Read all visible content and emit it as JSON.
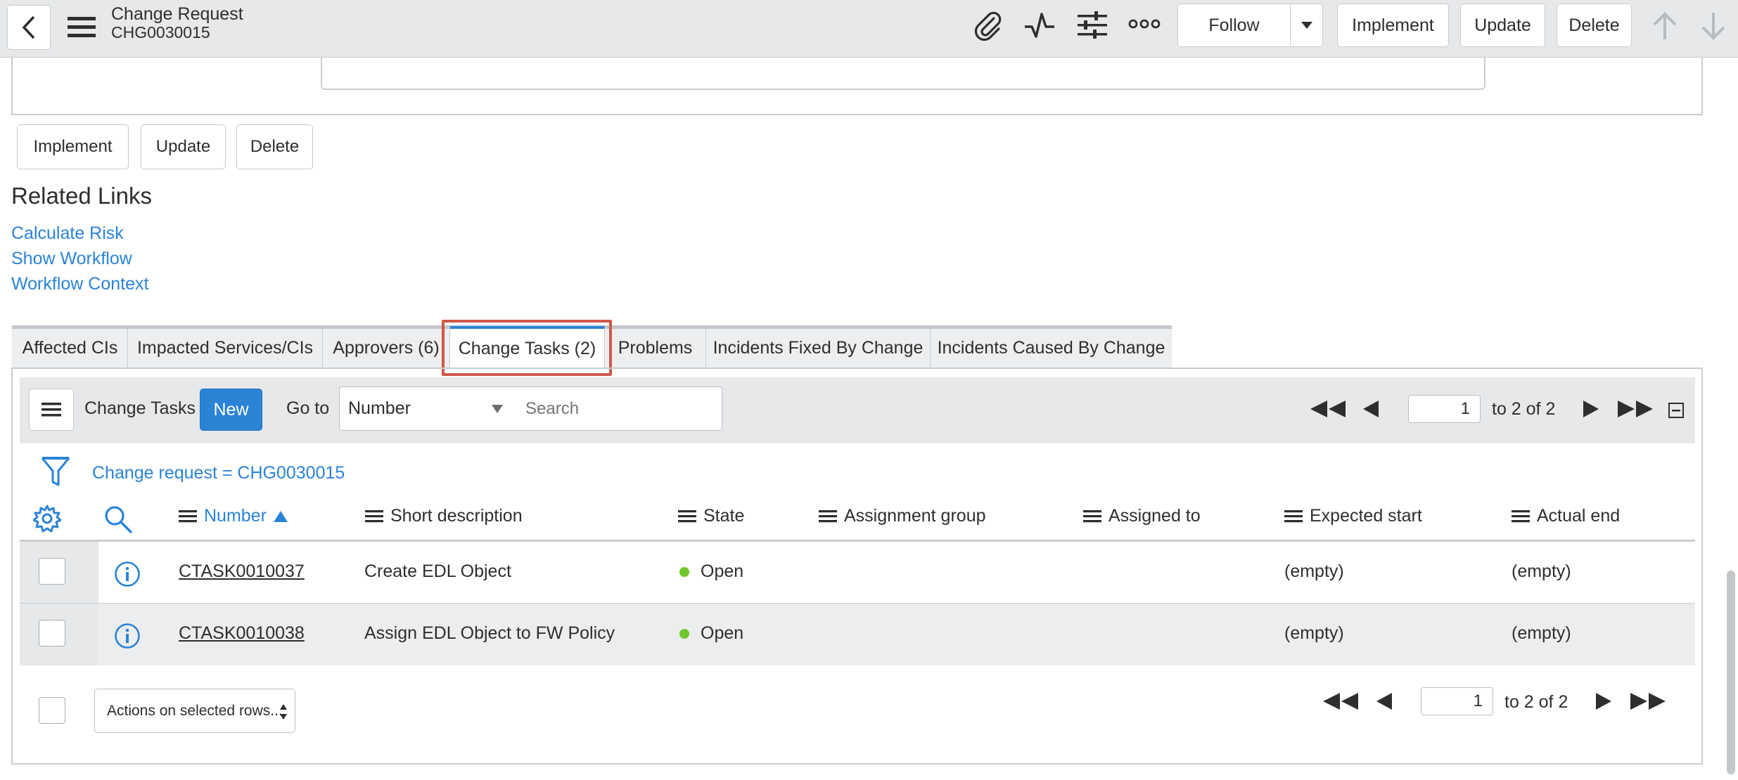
{
  "header": {
    "record_type": "Change Request",
    "record_number": "CHG0030015",
    "follow_label": "Follow",
    "implement_label": "Implement",
    "update_label": "Update",
    "delete_label": "Delete"
  },
  "form_buttons": {
    "implement_label": "Implement",
    "update_label": "Update",
    "delete_label": "Delete"
  },
  "related_links": {
    "title": "Related Links",
    "links": [
      "Calculate Risk",
      "Show Workflow",
      "Workflow Context"
    ]
  },
  "tabs": [
    {
      "label": "Affected CIs"
    },
    {
      "label": "Impacted Services/CIs"
    },
    {
      "label": "Approvers (6)"
    },
    {
      "label": "Change Tasks (2)",
      "active": true
    },
    {
      "label": "Problems"
    },
    {
      "label": "Incidents Fixed By Change"
    },
    {
      "label": "Incidents Caused By Change"
    }
  ],
  "list": {
    "title": "Change Tasks",
    "new_label": "New",
    "goto_label": "Go to",
    "goto_select": "Number",
    "search_placeholder": "Search",
    "page_value": "1",
    "page_range": "to 2 of 2",
    "filter_text": "Change request = CHG0030015",
    "columns": [
      "Number",
      "Short description",
      "State",
      "Assignment group",
      "Assigned to",
      "Expected start",
      "Actual end"
    ],
    "rows": [
      {
        "number": "CTASK0010037",
        "short_description": "Create EDL Object",
        "state": "Open",
        "assignment_group": "",
        "assigned_to": "",
        "expected_start": "(empty)",
        "actual_end": "(empty)"
      },
      {
        "number": "CTASK0010038",
        "short_description": "Assign EDL Object to FW Policy",
        "state": "Open",
        "assignment_group": "",
        "assigned_to": "",
        "expected_start": "(empty)",
        "actual_end": "(empty)"
      }
    ],
    "actions_select": "Actions on selected rows..."
  },
  "colors": {
    "link_blue": "#2b83d6",
    "primary_button": "#2b83d6",
    "state_open": "#71c52c",
    "tab_highlight": "#d1564b"
  }
}
